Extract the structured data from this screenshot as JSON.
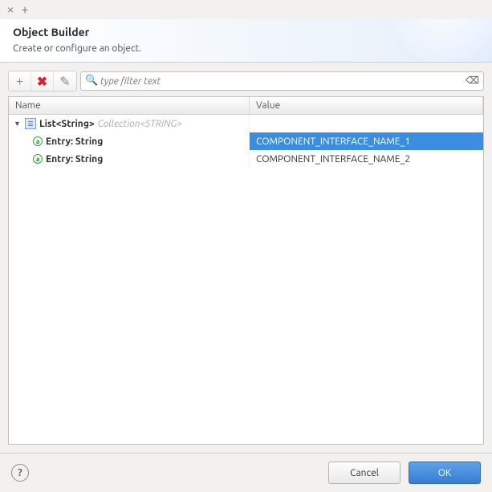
{
  "titlebar": {
    "close": "×",
    "new": "+"
  },
  "header": {
    "title": "Object Builder",
    "subtitle": "Create or configure an object."
  },
  "toolbar": {
    "add": "+",
    "remove": "✖",
    "edit": "✎"
  },
  "search": {
    "placeholder": "type filter text",
    "value": ""
  },
  "columns": {
    "name": "Name",
    "value": "Value"
  },
  "tree": {
    "root": {
      "label": "List<String>",
      "hint": "Collection<STRING>"
    },
    "rows": [
      {
        "label": "Entry: String",
        "value": "COMPONENT_INTERFACE_NAME_1",
        "selected": true
      },
      {
        "label": "Entry: String",
        "value": "COMPONENT_INTERFACE_NAME_2",
        "selected": false
      }
    ]
  },
  "footer": {
    "help": "?",
    "cancel": "Cancel",
    "ok": "OK"
  }
}
